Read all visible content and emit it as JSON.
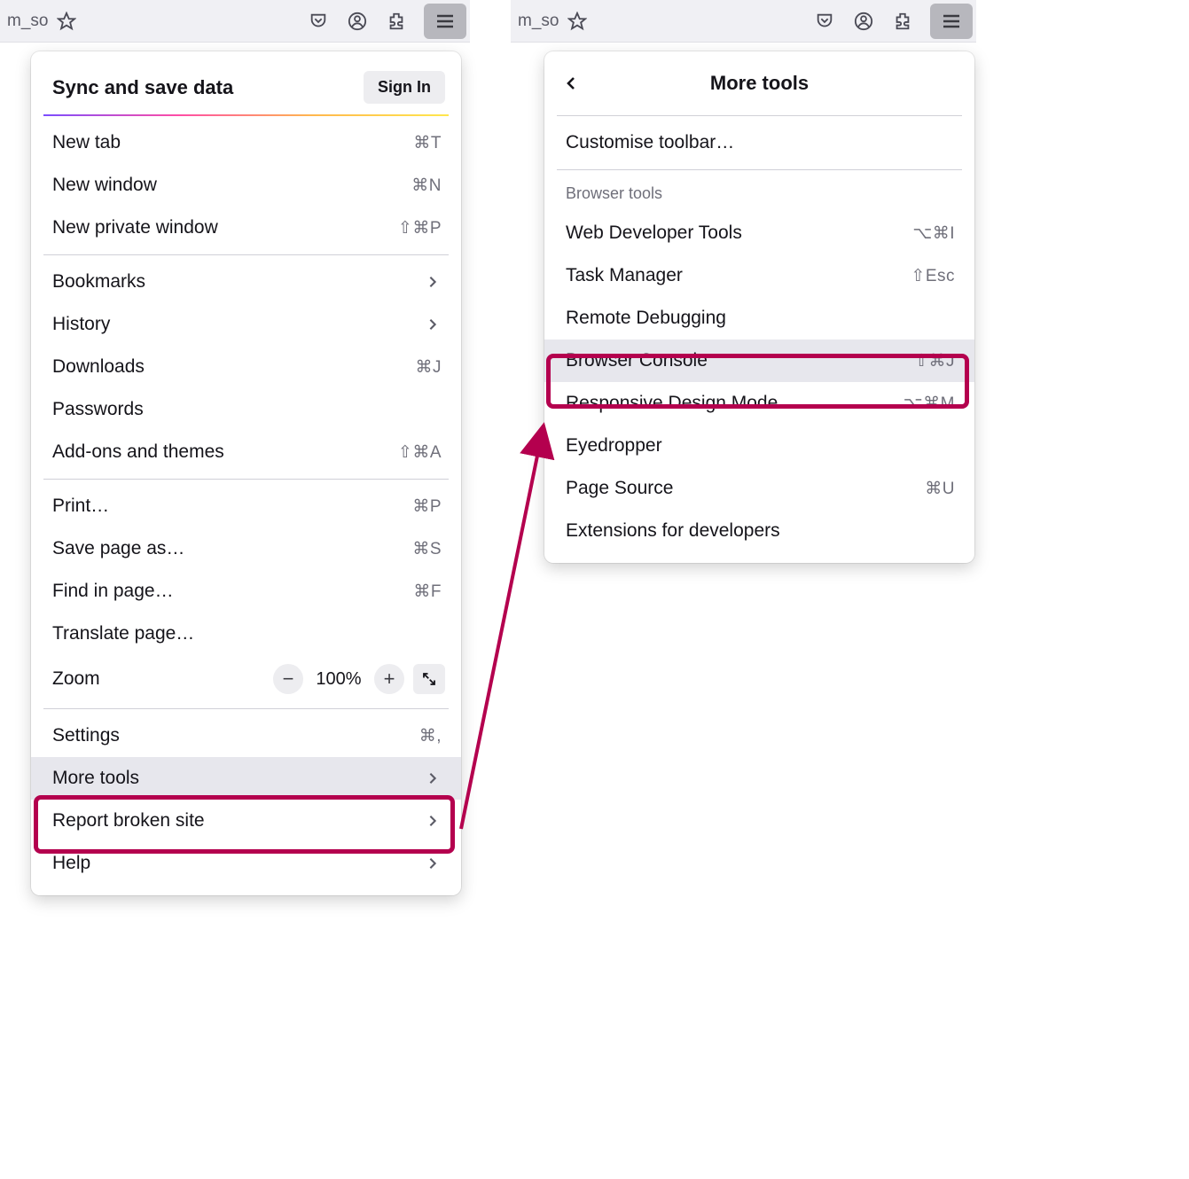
{
  "toolbar": {
    "url_frag": "m_so",
    "hamburger": "menu"
  },
  "mainMenu": {
    "syncTitle": "Sync and save data",
    "signIn": "Sign In",
    "items": {
      "newTab": {
        "label": "New tab",
        "shortcut": "⌘T"
      },
      "newWindow": {
        "label": "New window",
        "shortcut": "⌘N"
      },
      "newPrivate": {
        "label": "New private window",
        "shortcut": "⇧⌘P"
      },
      "bookmarks": {
        "label": "Bookmarks"
      },
      "history": {
        "label": "History"
      },
      "downloads": {
        "label": "Downloads",
        "shortcut": "⌘J"
      },
      "passwords": {
        "label": "Passwords"
      },
      "addons": {
        "label": "Add-ons and themes",
        "shortcut": "⇧⌘A"
      },
      "print": {
        "label": "Print…",
        "shortcut": "⌘P"
      },
      "savePage": {
        "label": "Save page as…",
        "shortcut": "⌘S"
      },
      "findInPage": {
        "label": "Find in page…",
        "shortcut": "⌘F"
      },
      "translate": {
        "label": "Translate page…"
      },
      "zoom": {
        "label": "Zoom",
        "value": "100%"
      },
      "settings": {
        "label": "Settings",
        "shortcut": "⌘,"
      },
      "moreTools": {
        "label": "More tools"
      },
      "reportBroken": {
        "label": "Report broken site"
      },
      "help": {
        "label": "Help"
      }
    }
  },
  "moreToolsMenu": {
    "title": "More tools",
    "customise": "Customise toolbar…",
    "sectionLabel": "Browser tools",
    "items": {
      "webDev": {
        "label": "Web Developer Tools",
        "shortcut": "⌥⌘I"
      },
      "taskMgr": {
        "label": "Task Manager",
        "shortcut": "⇧Esc"
      },
      "remoteDbg": {
        "label": "Remote Debugging"
      },
      "console": {
        "label": "Browser Console",
        "shortcut": "⇧⌘J"
      },
      "responsive": {
        "label": "Responsive Design Mode",
        "shortcut": "⌥⌘M"
      },
      "eyedropper": {
        "label": "Eyedropper"
      },
      "pageSource": {
        "label": "Page Source",
        "shortcut": "⌘U"
      },
      "extDev": {
        "label": "Extensions for developers"
      }
    }
  }
}
